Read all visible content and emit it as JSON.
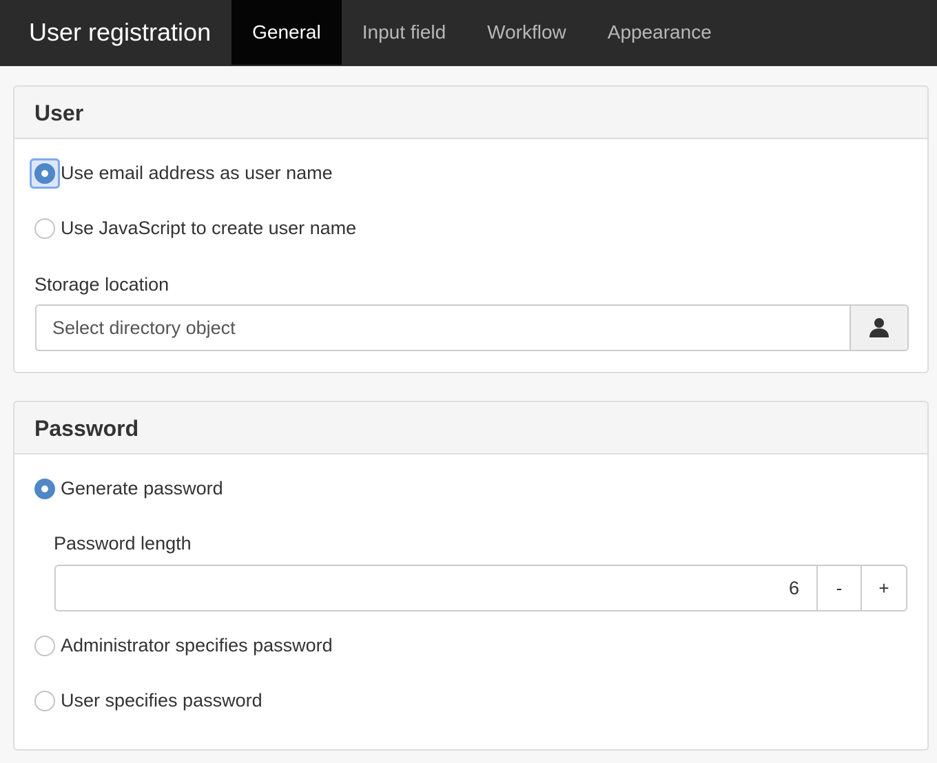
{
  "header": {
    "title": "User registration",
    "tabs": [
      {
        "label": "General",
        "active": true
      },
      {
        "label": "Input field",
        "active": false
      },
      {
        "label": "Workflow",
        "active": false
      },
      {
        "label": "Appearance",
        "active": false
      }
    ]
  },
  "user_section": {
    "title": "User",
    "options": [
      {
        "label": "Use email address as user name",
        "checked": true
      },
      {
        "label": "Use JavaScript to create user name",
        "checked": false
      }
    ],
    "storage_label": "Storage location",
    "storage_placeholder": "Select directory object",
    "storage_button_icon": "user-icon"
  },
  "password_section": {
    "title": "Password",
    "options": [
      {
        "label": "Generate password",
        "checked": true
      },
      {
        "label": "Administrator specifies password",
        "checked": false
      },
      {
        "label": "User specifies password",
        "checked": false
      }
    ],
    "length_label": "Password length",
    "length_value": "6",
    "decrement_label": "-",
    "increment_label": "+"
  },
  "colors": {
    "topbar": "#2b2b2b",
    "active_tab": "#050505",
    "accent": "#4f87c7"
  }
}
